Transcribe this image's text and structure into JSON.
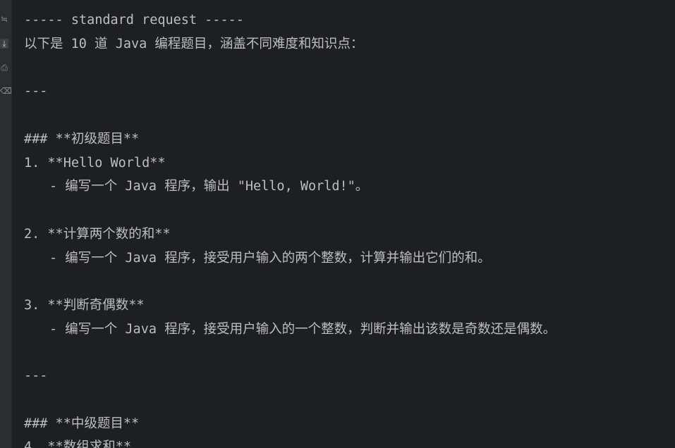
{
  "gutter": {
    "icons": [
      {
        "name": "soft-wrap-icon",
        "glyph": "≒"
      },
      {
        "name": "scroll-to-end-icon",
        "glyph": "⤓"
      },
      {
        "name": "print-icon",
        "glyph": "⎙"
      },
      {
        "name": "clear-icon",
        "glyph": "⌫"
      }
    ]
  },
  "console": {
    "lines": [
      "----- standard request -----",
      "以下是 10 道 Java 编程题目，涵盖不同难度和知识点：",
      "",
      "---",
      "",
      "### **初级题目**",
      "1. **Hello World**",
      "- 编写一个 Java 程序，输出 \"Hello, World!\"。",
      "",
      "2. **计算两个数的和**",
      "- 编写一个 Java 程序，接受用户输入的两个整数，计算并输出它们的和。",
      "",
      "3. **判断奇偶数**",
      "- 编写一个 Java 程序，接受用户输入的一个整数，判断并输出该数是奇数还是偶数。",
      "",
      "---",
      "",
      "### **中级题目**",
      "4. **数组求和**"
    ]
  }
}
